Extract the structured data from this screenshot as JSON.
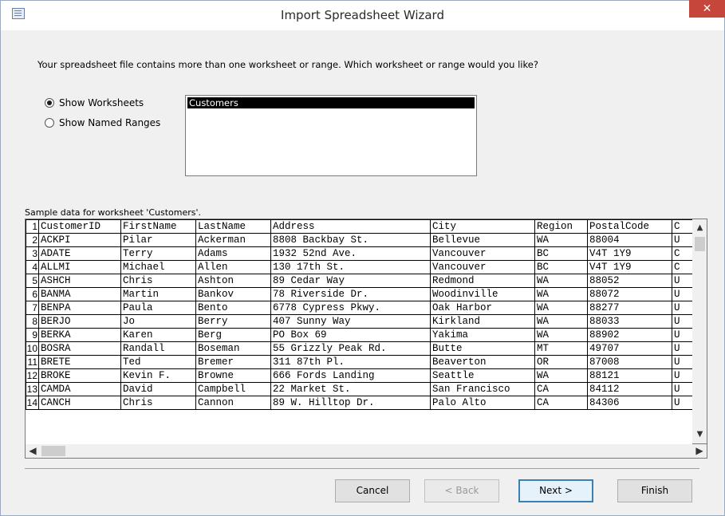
{
  "window": {
    "title": "Import Spreadsheet Wizard",
    "close_glyph": "✕"
  },
  "prompt": "Your spreadsheet file contains more than one worksheet or range. Which worksheet or range would you like?",
  "options": {
    "show_worksheets": "Show Worksheets",
    "show_named_ranges": "Show Named Ranges",
    "selected": "show_worksheets"
  },
  "worksheets": [
    "Customers"
  ],
  "sample_label": "Sample data for worksheet 'Customers'.",
  "columns": [
    {
      "w": 103
    },
    {
      "w": 94
    },
    {
      "w": 94
    },
    {
      "w": 200
    },
    {
      "w": 131
    },
    {
      "w": 66
    },
    {
      "w": 106
    },
    {
      "w": 26
    }
  ],
  "rows": [
    [
      "CustomerID",
      "FirstName",
      "LastName",
      "Address",
      "City",
      "Region",
      "PostalCode",
      "C"
    ],
    [
      "ACKPI",
      "Pilar",
      "Ackerman",
      "8808 Backbay St.",
      "Bellevue",
      "WA",
      "88004",
      "U"
    ],
    [
      "ADATE",
      "Terry",
      "Adams",
      "1932 52nd Ave.",
      "Vancouver",
      "BC",
      "V4T 1Y9",
      "C"
    ],
    [
      "ALLMI",
      "Michael",
      "Allen",
      "130 17th St.",
      "Vancouver",
      "BC",
      "V4T 1Y9",
      "C"
    ],
    [
      "ASHCH",
      "Chris",
      "Ashton",
      "89 Cedar Way",
      "Redmond",
      "WA",
      "88052",
      "U"
    ],
    [
      "BANMA",
      "Martin",
      "Bankov",
      "78 Riverside Dr.",
      "Woodinville",
      "WA",
      "88072",
      "U"
    ],
    [
      "BENPA",
      "Paula",
      "Bento",
      "6778 Cypress Pkwy.",
      "Oak Harbor",
      "WA",
      "88277",
      "U"
    ],
    [
      "BERJO",
      "Jo",
      "Berry",
      "407 Sunny Way",
      "Kirkland",
      "WA",
      "88033",
      "U"
    ],
    [
      "BERKA",
      "Karen",
      "Berg",
      "PO Box 69",
      "Yakima",
      "WA",
      "88902",
      "U"
    ],
    [
      "BOSRA",
      "Randall",
      "Boseman",
      "55 Grizzly Peak Rd.",
      "Butte",
      "MT",
      "49707",
      "U"
    ],
    [
      "BRETE",
      "Ted",
      "Bremer",
      "311 87th Pl.",
      "Beaverton",
      "OR",
      "87008",
      "U"
    ],
    [
      "BROKE",
      "Kevin F.",
      "Browne",
      "666 Fords Landing",
      "Seattle",
      "WA",
      "88121",
      "U"
    ],
    [
      "CAMDA",
      "David",
      "Campbell",
      "22 Market St.",
      "San Francisco",
      "CA",
      "84112",
      "U"
    ],
    [
      "CANCH",
      "Chris",
      "Cannon",
      "89 W. Hilltop Dr.",
      "Palo Alto",
      "CA",
      "84306",
      "U"
    ]
  ],
  "buttons": {
    "cancel": "Cancel",
    "back": "< Back",
    "next": "Next >",
    "finish": "Finish"
  },
  "icons": {
    "scroll_up": "▲",
    "scroll_down": "▼",
    "scroll_left": "◀",
    "scroll_right": "▶"
  }
}
